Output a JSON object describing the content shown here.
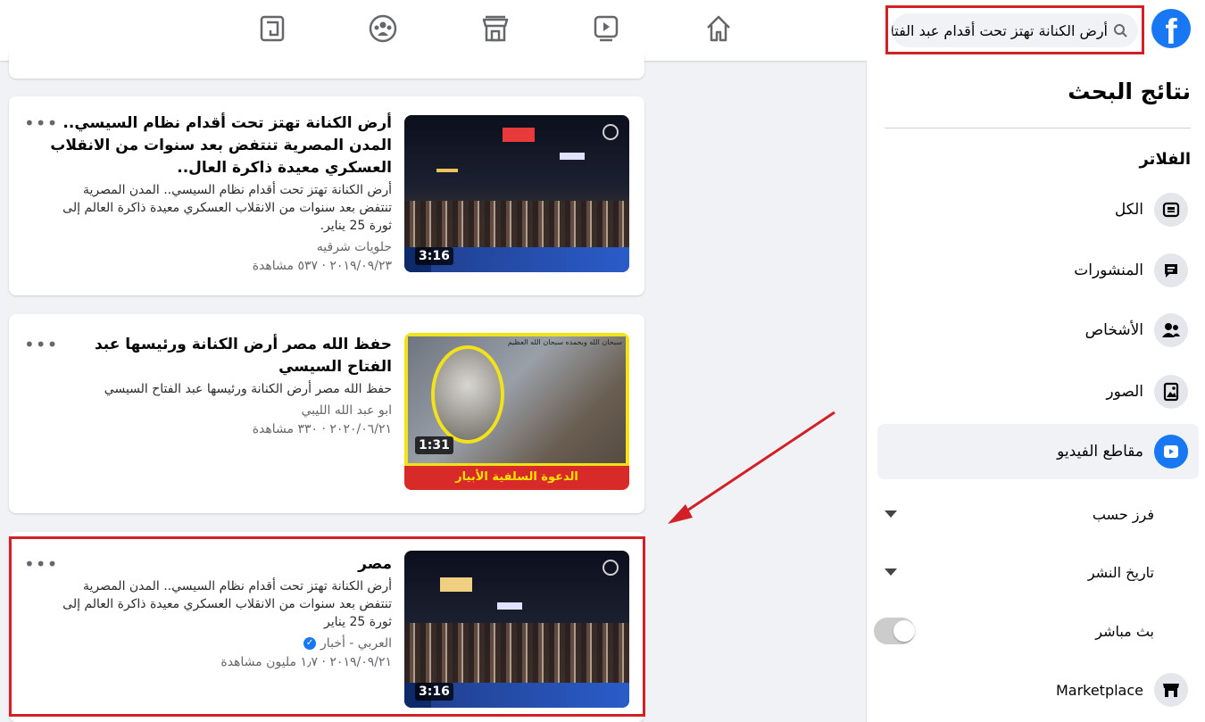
{
  "search": {
    "query": "أرض الكنانة تهتز تحت أقدام عبد الفتاح"
  },
  "logo": "f",
  "sidebar": {
    "title": "نتائج البحث",
    "filters_heading": "الفلاتر",
    "items": [
      {
        "label": "الكل",
        "icon": "grid-icon"
      },
      {
        "label": "المنشورات",
        "icon": "posts-icon"
      },
      {
        "label": "الأشخاص",
        "icon": "people-icon"
      },
      {
        "label": "الصور",
        "icon": "photos-icon"
      },
      {
        "label": "مقاطع الفيديو",
        "icon": "video-icon",
        "active": true
      }
    ],
    "sort_label": "فرز حسب",
    "date_label": "تاريخ النشر",
    "live_label": "بث مباشر",
    "marketplace_label": "Marketplace"
  },
  "results": [
    {
      "title": "أرض الكنانة تهتز تحت أقدام نظام السيسي.. المدن المصرية تنتفض بعد سنوات من الانقلاب العسكري معيدة ذاكرة العال..",
      "description": "أرض الكنانة تهتز تحت أقدام نظام السيسي.. المدن المصرية تنتفض بعد سنوات من الانقلاب العسكري معيدة ذاكرة العالم إلى ثورة 25 يناير.",
      "source": "حلويات شرقيه",
      "meta": "٢٠١٩/٠٩/٢٣ · ٥٣٧ مشاهدة",
      "duration": "3:16"
    },
    {
      "title": "حفظ الله مصر أرض الكنانة ورئيسها عبد الفتاح السيسي",
      "description": "حفظ الله مصر أرض الكنانة ورئيسها عبد الفتاح السيسي",
      "source": "ابو عبد الله الليبي",
      "meta": "٢٠٢٠/٠٦/٢١ · ٣٣٠ مشاهدة",
      "duration": "1:31",
      "banner": "الدعوة السلفية الأبيار",
      "top_text": "سبحان الله وبحمده سبحان الله العظيم"
    },
    {
      "title": "مصر",
      "description": "أرض الكنانة تهتز تحت أقدام نظام السيسي.. المدن المصرية تنتفض بعد سنوات من الانقلاب العسكري معيدة ذاكرة العالم إلى ثورة 25 يناير",
      "source": "العربي - أخبار",
      "verified": true,
      "meta": "٢٠١٩/٠٩/٢١ · ١٫٧ مليون مشاهدة",
      "duration": "3:16"
    }
  ],
  "more_label": "•••",
  "colors": {
    "brand": "#1877f2",
    "highlight": "#d32027",
    "background": "#f0f2f5"
  }
}
